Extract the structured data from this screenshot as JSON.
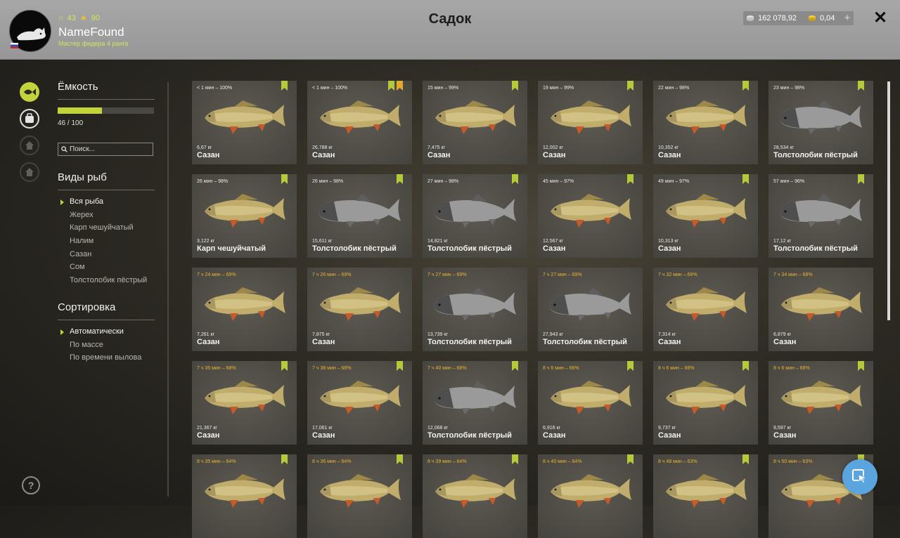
{
  "header": {
    "title": "Садок",
    "player": {
      "level": "43",
      "stars": "90",
      "name": "NameFound",
      "rank": "Мастер фидера 4 ранга"
    },
    "silver": "162 078,92",
    "gold": "0,04",
    "plus": "+",
    "close": "✕"
  },
  "sidebar": {
    "capacity_title": "Ёмкость",
    "capacity_text": "46 / 100",
    "capacity_fraction": 0.46,
    "search_placeholder": "Поиск...",
    "species_title": "Виды рыб",
    "species": [
      "Вся рыба",
      "Жерех",
      "Карп чешуйчатый",
      "Налим",
      "Сазан",
      "Сом",
      "Толстолобик пёстрый"
    ],
    "sort_title": "Сортировка",
    "sort": [
      "Автоматически",
      "По массе",
      "По времени вылова"
    ],
    "help": "?"
  },
  "colors": {
    "accent": "#c3d43b",
    "warn": "#e8b431",
    "fab": "#5aa5e0"
  },
  "cards": [
    {
      "time": "< 1 мин – 100%",
      "weight": "6,67 кг",
      "name": "Сазан",
      "kind": "carp",
      "marks": [
        "green"
      ],
      "warn": false
    },
    {
      "time": "< 1 мин – 100%",
      "weight": "26,788 кг",
      "name": "Сазан",
      "kind": "carp",
      "marks": [
        "green",
        "gold"
      ],
      "warn": false
    },
    {
      "time": "15 мин – 99%",
      "weight": "7,475 кг",
      "name": "Сазан",
      "kind": "carp",
      "marks": [
        "green"
      ],
      "warn": false
    },
    {
      "time": "19 мин – 99%",
      "weight": "12,002 кг",
      "name": "Сазан",
      "kind": "carp",
      "marks": [
        "green"
      ],
      "warn": false
    },
    {
      "time": "22 мин – 98%",
      "weight": "10,352 кг",
      "name": "Сазан",
      "kind": "carp",
      "marks": [
        "green"
      ],
      "warn": false
    },
    {
      "time": "23 мин – 98%",
      "weight": "28,534 кг",
      "name": "Толстолобик пёстрый",
      "kind": "bighead",
      "marks": [
        "green"
      ],
      "warn": false
    },
    {
      "time": "26 мин – 98%",
      "weight": "3,122 кг",
      "name": "Карп чешуйчатый",
      "kind": "carp",
      "marks": [
        "green"
      ],
      "warn": false
    },
    {
      "time": "26 мин – 98%",
      "weight": "15,611 кг",
      "name": "Толстолобик пёстрый",
      "kind": "bighead",
      "marks": [
        "green"
      ],
      "warn": false
    },
    {
      "time": "27 мин – 98%",
      "weight": "14,821 кг",
      "name": "Толстолобик пёстрый",
      "kind": "bighead",
      "marks": [
        "green"
      ],
      "warn": false
    },
    {
      "time": "45 мин – 97%",
      "weight": "12,567 кг",
      "name": "Сазан",
      "kind": "carp",
      "marks": [
        "green"
      ],
      "warn": false
    },
    {
      "time": "49 мин – 97%",
      "weight": "10,313 кг",
      "name": "Сазан",
      "kind": "carp",
      "marks": [
        "green"
      ],
      "warn": false
    },
    {
      "time": "57 мин – 96%",
      "weight": "17,12 кг",
      "name": "Толстолобик пёстрый",
      "kind": "bighead",
      "marks": [
        "green"
      ],
      "warn": false
    },
    {
      "time": "7 ч 24 мин – 69%",
      "weight": "7,261 кг",
      "name": "Сазан",
      "kind": "carp",
      "marks": [],
      "warn": true
    },
    {
      "time": "7 ч 26 мин – 69%",
      "weight": "7,875 кг",
      "name": "Сазан",
      "kind": "carp",
      "marks": [],
      "warn": true
    },
    {
      "time": "7 ч 27 мин – 69%",
      "weight": "13,739 кг",
      "name": "Толстолобик пёстрый",
      "kind": "bighead",
      "marks": [],
      "warn": true
    },
    {
      "time": "7 ч 27 мин – 69%",
      "weight": "27,943 кг",
      "name": "Толстолобик пёстрый",
      "kind": "bighead",
      "marks": [],
      "warn": true
    },
    {
      "time": "7 ч 32 мин – 69%",
      "weight": "7,314 кг",
      "name": "Сазан",
      "kind": "carp",
      "marks": [],
      "warn": true
    },
    {
      "time": "7 ч 34 мин – 68%",
      "weight": "6,879 кг",
      "name": "Сазан",
      "kind": "carp",
      "marks": [],
      "warn": true
    },
    {
      "time": "7 ч 35 мин – 68%",
      "weight": "21,367 кг",
      "name": "Сазан",
      "kind": "carp",
      "marks": [
        "green"
      ],
      "warn": true
    },
    {
      "time": "7 ч 38 мин – 68%",
      "weight": "17,061 кг",
      "name": "Сазан",
      "kind": "carp",
      "marks": [
        "green"
      ],
      "warn": true
    },
    {
      "time": "7 ч 40 мин – 68%",
      "weight": "12,068 кг",
      "name": "Толстолобик пёстрый",
      "kind": "bighead",
      "marks": [
        "green"
      ],
      "warn": true
    },
    {
      "time": "8 ч 6 мин – 66%",
      "weight": "6,916 кг",
      "name": "Сазан",
      "kind": "carp",
      "marks": [
        "green"
      ],
      "warn": true
    },
    {
      "time": "8 ч 6 мин – 66%",
      "weight": "9,737 кг",
      "name": "Сазан",
      "kind": "carp",
      "marks": [
        "green"
      ],
      "warn": true
    },
    {
      "time": "8 ч 6 мин – 66%",
      "weight": "9,597 кг",
      "name": "Сазан",
      "kind": "carp",
      "marks": [
        "green"
      ],
      "warn": true
    },
    {
      "time": "8 ч 35 мин – 64%",
      "weight": "",
      "name": "",
      "kind": "carp",
      "marks": [
        "green"
      ],
      "warn": true
    },
    {
      "time": "8 ч 36 мин – 64%",
      "weight": "",
      "name": "",
      "kind": "carp",
      "marks": [
        "green"
      ],
      "warn": true
    },
    {
      "time": "8 ч 39 мин – 64%",
      "weight": "",
      "name": "",
      "kind": "carp",
      "marks": [
        "green"
      ],
      "warn": true
    },
    {
      "time": "8 ч 40 мин – 64%",
      "weight": "",
      "name": "",
      "kind": "carp",
      "marks": [
        "green"
      ],
      "warn": true
    },
    {
      "time": "8 ч 48 мин – 63%",
      "weight": "",
      "name": "",
      "kind": "carp",
      "marks": [
        "green"
      ],
      "warn": true
    },
    {
      "time": "8 ч 50 мин – 63%",
      "weight": "",
      "name": "",
      "kind": "carp",
      "marks": [
        "green"
      ],
      "warn": true
    }
  ]
}
